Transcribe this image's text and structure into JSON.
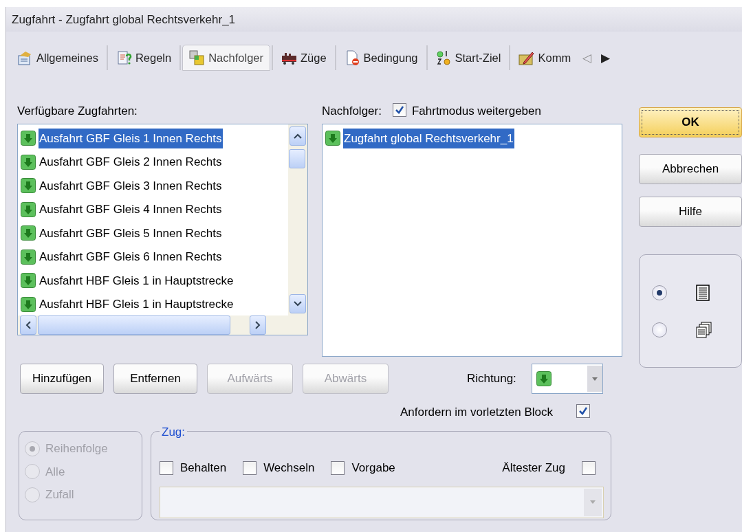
{
  "window": {
    "title": "Zugfahrt - Zugfahrt global Rechtsverkehr_1"
  },
  "tabs": [
    {
      "label": "Allgemeines",
      "selected": false
    },
    {
      "label": "Regeln",
      "selected": false
    },
    {
      "label": "Nachfolger",
      "selected": true
    },
    {
      "label": "Züge",
      "selected": false
    },
    {
      "label": "Bedingung",
      "selected": false
    },
    {
      "label": "Start-Ziel",
      "selected": false
    },
    {
      "label": "Komm",
      "selected": false
    }
  ],
  "tab_scroll": {
    "left": "◁",
    "right": "▶"
  },
  "available": {
    "label": "Verfügbare Zugfahrten:",
    "items": [
      {
        "text": "Ausfahrt GBF Gleis 1 Innen Rechts",
        "selected": true
      },
      {
        "text": "Ausfahrt GBF Gleis 2 Innen Rechts",
        "selected": false
      },
      {
        "text": "Ausfahrt GBF Gleis 3 Innen Rechts",
        "selected": false
      },
      {
        "text": "Ausfahrt GBF Gleis 4 Innen Rechts",
        "selected": false
      },
      {
        "text": "Ausfahrt GBF Gleis 5 Innen Rechts",
        "selected": false
      },
      {
        "text": "Ausfahrt GBF Gleis 6 Innen Rechts",
        "selected": false
      },
      {
        "text": "Ausfahrt HBF Gleis 1 in Hauptstrecke",
        "selected": false
      },
      {
        "text": "Ausfahrt HBF Gleis 1 in Hauptstrecke",
        "selected": false
      }
    ]
  },
  "successors": {
    "label": "Nachfolger:",
    "pass_mode": {
      "label": "Fahrtmodus weitergeben",
      "checked": true
    },
    "items": [
      {
        "text": "Zugfahrt global Rechtsverkehr_1",
        "selected": true
      }
    ]
  },
  "list_buttons": [
    {
      "label": "Hinzufügen",
      "disabled": false
    },
    {
      "label": "Entfernen",
      "disabled": false
    },
    {
      "label": "Aufwärts",
      "disabled": true
    },
    {
      "label": "Abwärts",
      "disabled": true
    }
  ],
  "direction": {
    "label": "Richtung:"
  },
  "request_block": {
    "label": "Anfordern im vorletzten Block",
    "checked": true
  },
  "order": [
    {
      "label": "Reihenfolge",
      "selected": true,
      "disabled": true
    },
    {
      "label": "Alle",
      "selected": false,
      "disabled": true
    },
    {
      "label": "Zufall",
      "selected": false,
      "disabled": true
    }
  ],
  "train_group": {
    "title": "Zug:",
    "options": [
      {
        "label": "Behalten",
        "checked": false
      },
      {
        "label": "Wechseln",
        "checked": false
      },
      {
        "label": "Vorgabe",
        "checked": false
      }
    ],
    "oldest": {
      "label": "Ältester Zug",
      "checked": false
    },
    "combo_disabled": true
  },
  "dialog_buttons": [
    {
      "label": "OK",
      "kind": "default"
    },
    {
      "label": "Abbrechen",
      "kind": "normal"
    },
    {
      "label": "Hilfe",
      "kind": "normal"
    }
  ],
  "view_mode": [
    {
      "selected": true
    },
    {
      "selected": false
    }
  ]
}
